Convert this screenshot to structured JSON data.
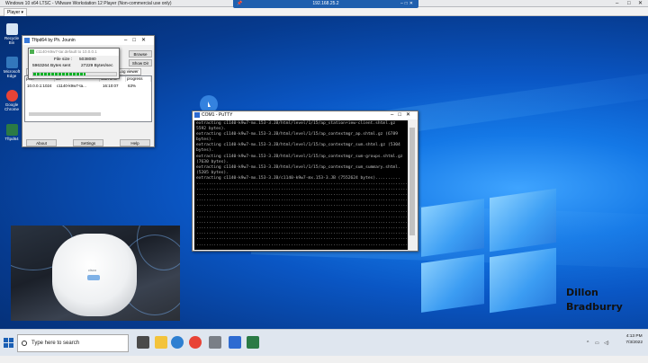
{
  "vmware": {
    "title": "Windows 10 x64 LTSC - VMware Workstation 12 Player (Non-commercial use only)",
    "player_menu": "Player ▾",
    "host_label": "192.168.25.2",
    "pin_icon": "pin-icon"
  },
  "desktop_icons": [
    {
      "label": "Recycle Bin",
      "color": "#d7e6f5"
    },
    {
      "label": "Microsoft Edge",
      "color": "#3277bc"
    },
    {
      "label": "Google Chrome",
      "color": "#e84336"
    },
    {
      "label": "Tftpd64",
      "color": "#2b7a45"
    }
  ],
  "tftpd": {
    "title": "Tftpd64 by Ph. Jounin",
    "browse": "Browse",
    "show_dir": "Show Dir",
    "server_interface": "10.0.0.1",
    "tabs": [
      "Tftp Server",
      "Tftp Client",
      "Log viewer"
    ],
    "columns": [
      "peer",
      "file",
      "start time",
      "progress"
    ],
    "row": {
      "peer": "10.0.0.1:1024",
      "file": "c1140-k9w7-ta...",
      "start": "16:10:07",
      "progress": "63%"
    },
    "about": "About",
    "settings": "Settings",
    "help": "Help",
    "transfer": {
      "title": "c1140-k9w7-tar.default to 10.0.0.1",
      "file_size_label": "File size :",
      "file_size": "5038080",
      "bytes_sent": "5963264 Bytes sent",
      "rate": "27229 Bytes/sec",
      "progress": 0.63
    }
  },
  "putty": {
    "title": "COM1 - PuTTY",
    "lines": [
      "extracting c1140-k9w7-mx.153-3.JB/html/level/1/15/ap_station+iew-client.shtml.gz",
      "5592 bytes).",
      "extracting c1140-k9w7-mx.153-3.JB/html/level/1/15/ap_contextmgr_ap.shtml.gz (6789",
      "bytes).",
      "extracting c1140-k9w7-mx.153-3.JB/html/level/1/15/ap_contextmgr_sum.shtml.gz (5304",
      "bytes).",
      "extracting c1140-k9w7-mx.153-3.JB/html/level/1/15/ap_contextmgr_sum-groups.shtml.gz",
      "(7630 bytes).",
      "extracting c1140-k9w7-mx.153-3.JB/html/level/1/15/ap_contextmgr_sum_summary.shtml.",
      "(5205 bytes).",
      "extracting c1140-k9w7-mx.153-3.JB/c1140-k9w7-mx.153-3.JB (7552624 bytes)..........",
      "......................................................................................",
      "......................................................................................",
      "......................................................................................",
      "......................................................................................",
      "......................................................................................",
      "......................................................................................",
      "......................................................................................",
      "......................................................................................",
      "......................................................................................",
      "......................................................................................",
      "......................................................................................",
      "...................................................................................... "
    ]
  },
  "webcam": {
    "brand": "cisco"
  },
  "signature": {
    "line1": "Dillon",
    "line2": "Bradburry"
  },
  "taskbar": {
    "search_placeholder": "Type here to search",
    "time": "4:13 PM",
    "date": "7/3/2022",
    "apps": [
      {
        "name": "task-view-icon",
        "color": "#4a4a4a"
      },
      {
        "name": "file-explorer-icon",
        "color": "#f3c33b"
      },
      {
        "name": "edge-icon",
        "color": "#2e7fd1"
      },
      {
        "name": "chrome-icon",
        "color": "#e84336"
      },
      {
        "name": "vmware-icon",
        "color": "#7a7f87"
      },
      {
        "name": "putty-icon",
        "color": "#2e6bd1"
      },
      {
        "name": "tftpd-icon",
        "color": "#2b7a45"
      }
    ]
  }
}
